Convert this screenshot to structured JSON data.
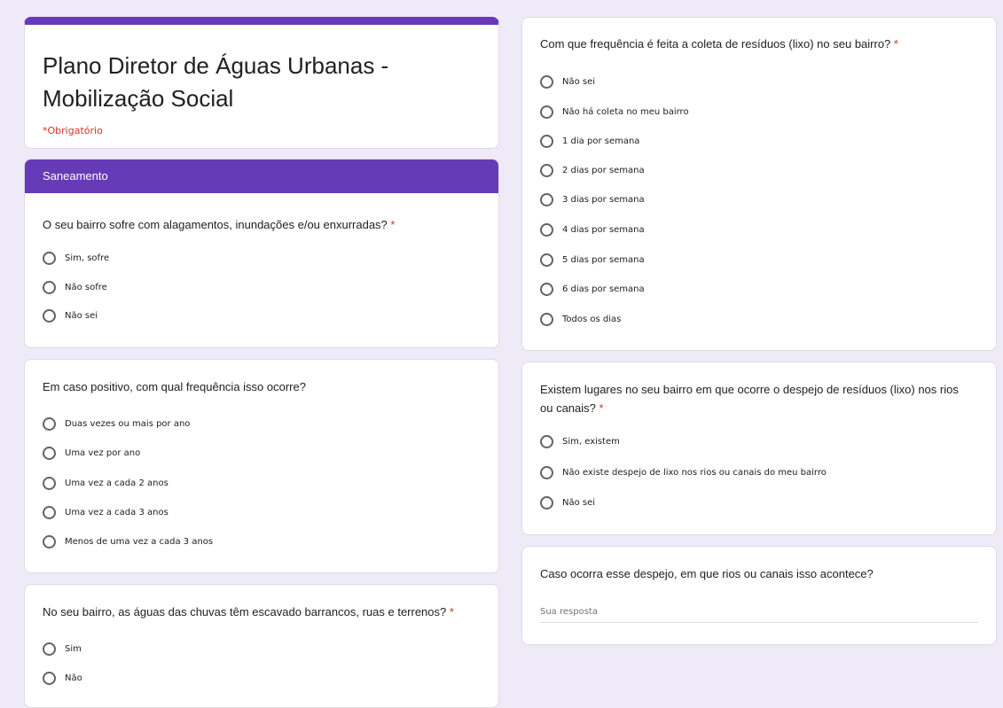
{
  "form": {
    "title_line1": "Plano Diretor de Águas Urbanas -",
    "title_line2": "Mobilização Social",
    "required_note": "*Obrigatório"
  },
  "section": {
    "title": "Saneamento"
  },
  "required_marker": "*",
  "questions": [
    {
      "title": "O seu bairro sofre com alagamentos, inundações e/ou enxurradas?",
      "required": true,
      "options": [
        "Sim, sofre",
        "Não sofre",
        "Não sei"
      ]
    },
    {
      "title": "Em caso positivo, com qual frequência isso ocorre?",
      "required": false,
      "options": [
        "Duas vezes ou mais por ano",
        "Uma vez por ano",
        "Uma vez a cada 2 anos",
        "Uma vez a cada 3 anos",
        "Menos de uma vez a cada 3 anos"
      ]
    },
    {
      "title": "No seu bairro, as águas das chuvas têm escavado barrancos, ruas e terrenos?",
      "required": true,
      "options": [
        "Sim",
        "Não"
      ]
    },
    {
      "title": "Com que frequência é feita a coleta de resíduos (lixo) no seu bairro?",
      "required": true,
      "options": [
        "Não sei",
        "Não há coleta no meu bairro",
        "1 dia por semana",
        "2 dias por semana",
        "3 dias por semana",
        "4 dias por semana",
        "5 dias por semana",
        "6 dias por semana",
        "Todos os dias"
      ]
    },
    {
      "title_line1": "Existem lugares no seu bairro em que ocorre o despejo de resíduos (lixo) nos rios",
      "title_line2": "ou canais?",
      "required": true,
      "options": [
        "Sim, existem",
        "Não existe despejo de lixo nos rios ou canais do meu bairro",
        "Não sei"
      ]
    },
    {
      "title": "Caso ocorra esse despejo, em que rios ou canais isso acontece?",
      "required": false,
      "placeholder": "Sua resposta"
    }
  ]
}
